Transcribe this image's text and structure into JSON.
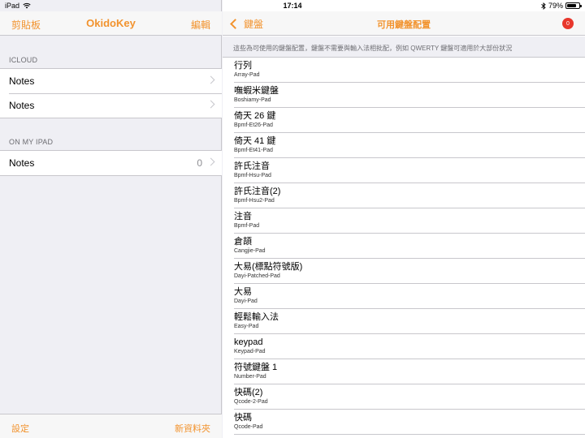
{
  "status_bar": {
    "device": "iPad",
    "time": "17:14",
    "battery_percent": "79%",
    "battery_level": 0.79
  },
  "left_panel": {
    "nav": {
      "left_button": "剪貼板",
      "title": "OkidoKey",
      "right_button": "編輯"
    },
    "sections": [
      {
        "header": "ICLOUD",
        "rows": [
          {
            "label": "Notes"
          },
          {
            "label": "Notes"
          }
        ]
      },
      {
        "header": "ON MY IPAD",
        "rows": [
          {
            "label": "Notes",
            "count": "0"
          }
        ]
      }
    ],
    "toolbar": {
      "left_button": "設定",
      "right_button": "新資料夾"
    }
  },
  "right_panel": {
    "nav": {
      "back_label": "鍵盤",
      "title": "可用鍵盤配置",
      "badge": "0"
    },
    "description": "這些為可使用的鍵盤配置，鍵盤不需要與輸入法相批配，例如 QWERTY 鍵盤可適用於大部份狀況",
    "keyboards": [
      {
        "name": "行列",
        "id": "Array-Pad"
      },
      {
        "name": "嘸蝦米鍵盤",
        "id": "Boshiamy-Pad"
      },
      {
        "name": "倚天 26 鍵",
        "id": "Bpmf-Et26-Pad"
      },
      {
        "name": "倚天 41 鍵",
        "id": "Bpmf-Et41-Pad"
      },
      {
        "name": "許氏注音",
        "id": "Bpmf-Hsu-Pad"
      },
      {
        "name": "許氏注音(2)",
        "id": "Bpmf-Hsu2-Pad"
      },
      {
        "name": "注音",
        "id": "Bpmf-Pad"
      },
      {
        "name": "倉頡",
        "id": "Cangjie-Pad"
      },
      {
        "name": "大易(標點符號版)",
        "id": "Dayi-Patched-Pad"
      },
      {
        "name": "大易",
        "id": "Dayi-Pad"
      },
      {
        "name": "輕鬆輸入法",
        "id": "Easy-Pad"
      },
      {
        "name": "keypad",
        "id": "Keypad-Pad"
      },
      {
        "name": "符號鍵盤 1",
        "id": "Number-Pad"
      },
      {
        "name": "快碼(2)",
        "id": "Qcode-2-Pad"
      },
      {
        "name": "快碼",
        "id": "Qcode-Pad"
      }
    ]
  },
  "colors": {
    "accent": "#f2932e",
    "badge": "#e8372c",
    "background": "#efeff4"
  }
}
